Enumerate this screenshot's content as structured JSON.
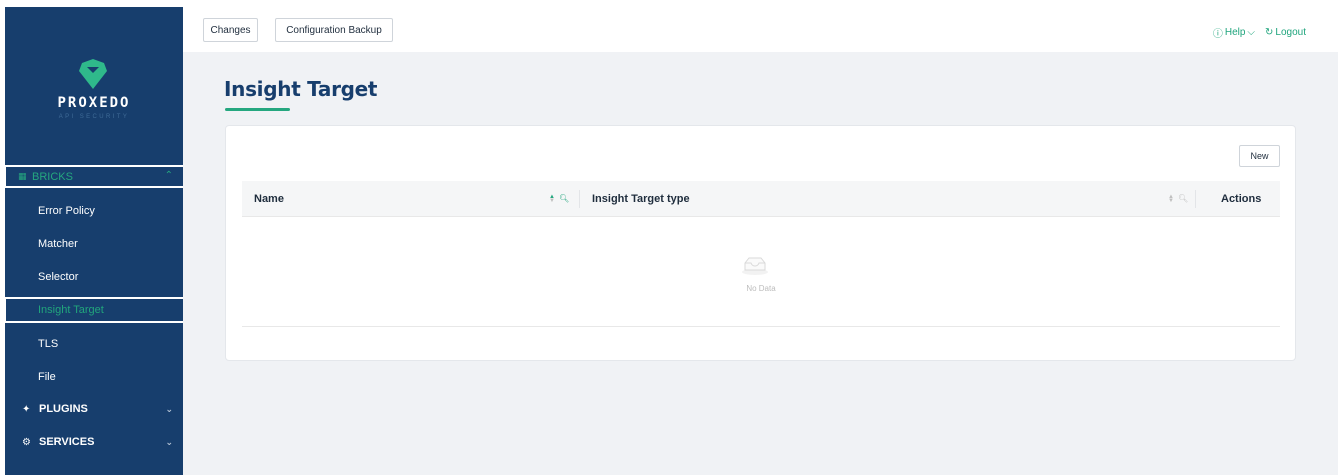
{
  "brand": {
    "name": "PROXEDO",
    "subtitle": "API SECURITY"
  },
  "sidebar": {
    "group": {
      "label": "BRICKS",
      "icon": "grid-icon",
      "expanded": true
    },
    "items": [
      {
        "label": "Error Policy"
      },
      {
        "label": "Matcher"
      },
      {
        "label": "Selector"
      },
      {
        "label": "Insight Target",
        "active": true
      },
      {
        "label": "TLS"
      },
      {
        "label": "File"
      }
    ],
    "plugins": {
      "label": "PLUGINS",
      "icon": "plug-icon"
    },
    "services": {
      "label": "SERVICES",
      "icon": "gear-icon"
    }
  },
  "header": {
    "changes_label": "Changes",
    "backup_label": "Configuration Backup",
    "help_label": "Help",
    "logout_label": "Logout"
  },
  "main": {
    "title": "Insight Target",
    "new_label": "New",
    "table": {
      "columns": [
        "Name",
        "Insight Target type",
        "Actions"
      ],
      "rows": [],
      "empty_text": "No Data"
    }
  },
  "colors": {
    "sidebar": "#173e6d",
    "accent": "#25a77f",
    "background": "#f0f2f5"
  }
}
